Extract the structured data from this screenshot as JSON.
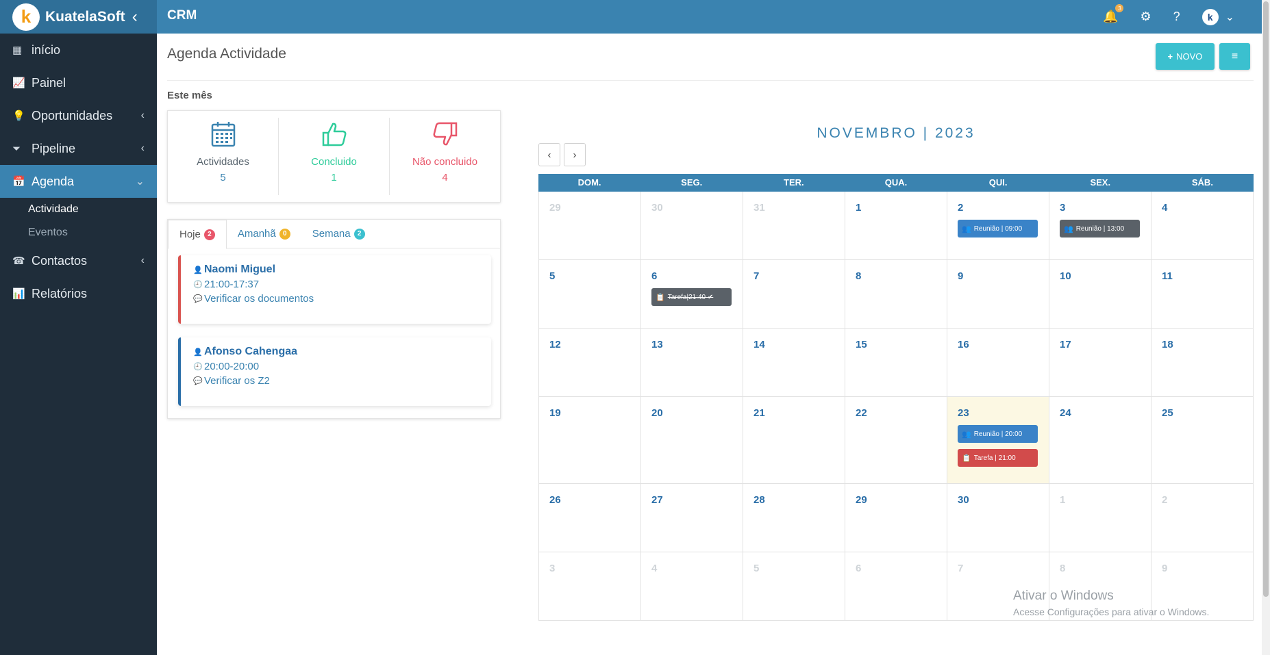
{
  "brand": {
    "name": "KuatelaSoft",
    "logo_letter": "k"
  },
  "header": {
    "app_title": "CRM",
    "notification_count": "3"
  },
  "sidebar": {
    "items": [
      {
        "label": "início",
        "icon": "grid-icon",
        "glyph": "▦",
        "chevron": ""
      },
      {
        "label": "Painel",
        "icon": "presentation-icon",
        "glyph": "📈",
        "chevron": ""
      },
      {
        "label": "Oportunidades",
        "icon": "lightbulb-icon",
        "glyph": "💡",
        "chevron": "‹"
      },
      {
        "label": "Pipeline",
        "icon": "funnel-icon",
        "glyph": "⏷",
        "chevron": "‹"
      },
      {
        "label": "Agenda",
        "icon": "calendar-icon",
        "glyph": "📅",
        "chevron": "⌄"
      },
      {
        "label": "Contactos",
        "icon": "phone-book-icon",
        "glyph": "☎",
        "chevron": "‹"
      },
      {
        "label": "Relatórios",
        "icon": "chart-icon",
        "glyph": "📊",
        "chevron": ""
      }
    ],
    "agenda_sub": [
      {
        "label": "Actividade"
      },
      {
        "label": "Eventos"
      }
    ]
  },
  "page": {
    "title": "Agenda Actividade",
    "new_button": "NOVO",
    "section_label": "Este mês"
  },
  "stats": [
    {
      "label": "Actividades",
      "value": "5",
      "color": "#3a83b0",
      "icon": "calendar-icon"
    },
    {
      "label": "Concluido",
      "value": "1",
      "color": "#2ecc9a",
      "icon": "thumbs-up-icon"
    },
    {
      "label": "Não concluido",
      "value": "4",
      "color": "#e8566a",
      "icon": "thumbs-down-icon"
    }
  ],
  "tabs": [
    {
      "label": "Hoje",
      "count": "2",
      "color": "#e8566a"
    },
    {
      "label": "Amanhã",
      "count": "0",
      "color": "#f0b429"
    },
    {
      "label": "Semana",
      "count": "2",
      "color": "#3bc0cf"
    }
  ],
  "tasks": [
    {
      "name": "Naomi Miguel",
      "time": "21:00-17:37",
      "desc": "Verificar os documentos",
      "border_color": "#d9534f"
    },
    {
      "name": "Afonso Cahengaa",
      "time": "20:00-20:00",
      "desc": "Verificar os Z2",
      "border_color": "#2a6ea8"
    }
  ],
  "calendar": {
    "title": "NOVEMBRO | 2023",
    "prev": "‹",
    "next": "›",
    "weekdays": [
      "DOM.",
      "SEG.",
      "TER.",
      "QUA.",
      "QUI.",
      "SEX.",
      "SÁB."
    ],
    "weeks": [
      [
        {
          "d": "29",
          "m": true
        },
        {
          "d": "30",
          "m": true
        },
        {
          "d": "31",
          "m": true
        },
        {
          "d": "1"
        },
        {
          "d": "2",
          "events": [
            {
              "label": "Reunião | 09:00",
              "color": "#3a83c8",
              "icon": "meeting-icon",
              "glyph": "👥"
            }
          ]
        },
        {
          "d": "3",
          "events": [
            {
              "label": "Reunião | 13:00",
              "color": "#5a6168",
              "icon": "meeting-icon",
              "glyph": "👥"
            }
          ]
        },
        {
          "d": "4"
        }
      ],
      [
        {
          "d": "5"
        },
        {
          "d": "6",
          "events": [
            {
              "label": "Tarefa|21:40 ✔",
              "color": "#5a6168",
              "icon": "task-icon",
              "glyph": "📋",
              "done": true
            }
          ]
        },
        {
          "d": "7"
        },
        {
          "d": "8"
        },
        {
          "d": "9"
        },
        {
          "d": "10"
        },
        {
          "d": "11"
        }
      ],
      [
        {
          "d": "12"
        },
        {
          "d": "13"
        },
        {
          "d": "14"
        },
        {
          "d": "15"
        },
        {
          "d": "16"
        },
        {
          "d": "17"
        },
        {
          "d": "18"
        }
      ],
      [
        {
          "d": "19"
        },
        {
          "d": "20"
        },
        {
          "d": "21"
        },
        {
          "d": "22"
        },
        {
          "d": "23",
          "today": true,
          "events": [
            {
              "label": "Reunião | 20:00",
              "color": "#3a83c8",
              "icon": "meeting-icon",
              "glyph": "👥"
            },
            {
              "label": "Tarefa | 21:00",
              "color": "#d24b4b",
              "icon": "task-icon",
              "glyph": "📋"
            }
          ]
        },
        {
          "d": "24"
        },
        {
          "d": "25"
        }
      ],
      [
        {
          "d": "26"
        },
        {
          "d": "27"
        },
        {
          "d": "28"
        },
        {
          "d": "29"
        },
        {
          "d": "30"
        },
        {
          "d": "1",
          "m": true
        },
        {
          "d": "2",
          "m": true
        }
      ],
      [
        {
          "d": "3",
          "m": true
        },
        {
          "d": "4",
          "m": true
        },
        {
          "d": "5",
          "m": true
        },
        {
          "d": "6",
          "m": true
        },
        {
          "d": "7",
          "m": true
        },
        {
          "d": "8",
          "m": true
        },
        {
          "d": "9",
          "m": true
        }
      ]
    ]
  },
  "watermark": {
    "line1": "Ativar o Windows",
    "line2": "Acesse Configurações para ativar o Windows."
  }
}
